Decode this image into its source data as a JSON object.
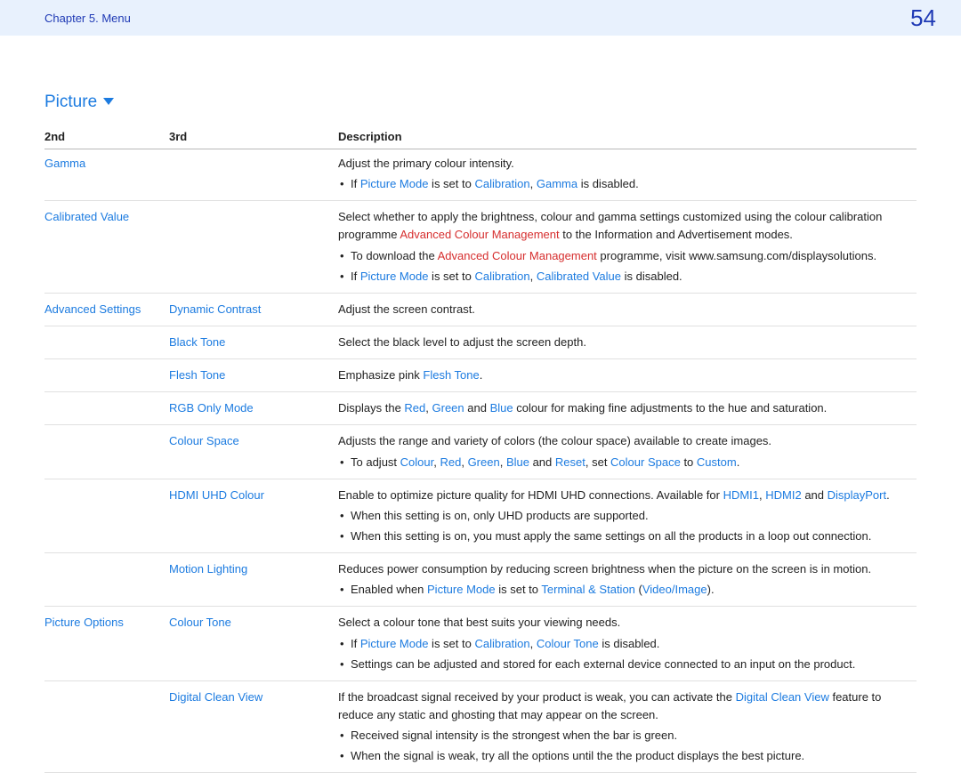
{
  "header": {
    "chapter": "Chapter 5. Menu",
    "page": "54"
  },
  "section": {
    "title": "Picture"
  },
  "columns": {
    "c2": "2nd",
    "c3": "3rd",
    "desc": "Description"
  },
  "rows": {
    "gamma": {
      "label": "Gamma",
      "desc": "Adjust the primary colour intensity.",
      "b1a": "If ",
      "b1b": "Picture Mode",
      "b1c": " is set to ",
      "b1d": "Calibration",
      "b1e": ", ",
      "b1f": "Gamma",
      "b1g": " is disabled."
    },
    "calibrated": {
      "label": "Calibrated Value",
      "p1a": "Select whether to apply the brightness, colour and gamma settings customized using the colour calibration programme ",
      "p1b": "Advanced Colour Management",
      "p1c": " to the Information and Advertisement modes.",
      "b1a": "To download the ",
      "b1b": "Advanced Colour Management",
      "b1c": " programme, visit www.samsung.com/displaysolutions.",
      "b2a": "If ",
      "b2b": "Picture Mode",
      "b2c": " is set to ",
      "b2d": "Calibration",
      "b2e": ", ",
      "b2f": "Calibrated Value",
      "b2g": " is disabled."
    },
    "adv": {
      "label": "Advanced Settings",
      "dyn": {
        "label": "Dynamic Contrast",
        "desc": "Adjust the screen contrast."
      },
      "black": {
        "label": "Black Tone",
        "desc": "Select the black level to adjust the screen depth."
      },
      "flesh": {
        "label": "Flesh Tone",
        "d1": "Emphasize pink ",
        "d2": "Flesh Tone",
        "d3": "."
      },
      "rgb": {
        "label": "RGB Only Mode",
        "d1": "Displays the ",
        "d2": "Red",
        "d3": ", ",
        "d4": "Green",
        "d5": " and ",
        "d6": "Blue",
        "d7": " colour for making fine adjustments to the hue and saturation."
      },
      "cspace": {
        "label": "Colour Space",
        "desc": "Adjusts the range and variety of colors (the colour space) available to create images.",
        "b1a": "To adjust ",
        "b1b": "Colour",
        "b1c": ", ",
        "b1d": "Red",
        "b1e": ", ",
        "b1f": "Green",
        "b1g": ", ",
        "b1h": "Blue",
        "b1i": " and ",
        "b1j": "Reset",
        "b1k": ", set ",
        "b1l": "Colour Space",
        "b1m": " to ",
        "b1n": "Custom",
        "b1o": "."
      },
      "hdmi": {
        "label": "HDMI UHD Colour",
        "p1a": "Enable to optimize picture quality for HDMI UHD connections. Available for ",
        "p1b": "HDMI1",
        "p1c": ", ",
        "p1d": "HDMI2",
        "p1e": " and ",
        "p1f": "DisplayPort",
        "p1g": ".",
        "b1": "When this setting is on, only UHD products are supported.",
        "b2": "When this setting is on, you must apply the same settings on all the products in a loop out connection."
      },
      "motion": {
        "label": "Motion Lighting",
        "desc": "Reduces power consumption by reducing screen brightness when the picture on the screen is in motion.",
        "b1a": "Enabled when ",
        "b1b": "Picture Mode",
        "b1c": " is set to ",
        "b1d": "Terminal & Station",
        "b1e": " (",
        "b1f": "Video/Image",
        "b1g": ")."
      }
    },
    "popts": {
      "label": "Picture Options",
      "ctone": {
        "label": "Colour Tone",
        "desc": "Select a colour tone that best suits your viewing needs.",
        "b1a": "If ",
        "b1b": "Picture Mode",
        "b1c": " is set to ",
        "b1d": "Calibration",
        "b1e": ", ",
        "b1f": "Colour Tone",
        "b1g": " is disabled.",
        "b2": "Settings can be adjusted and stored for each external device connected to an input on the product."
      },
      "dcv": {
        "label": "Digital Clean View",
        "p1a": "If the broadcast signal received by your product is weak, you can activate the ",
        "p1b": "Digital Clean View",
        "p1c": " feature to reduce any static and ghosting that may appear on the screen.",
        "b1": "Received signal intensity is the strongest when the bar is green.",
        "b2": "When the signal is weak, try all the options until the the product displays the best picture."
      }
    }
  }
}
